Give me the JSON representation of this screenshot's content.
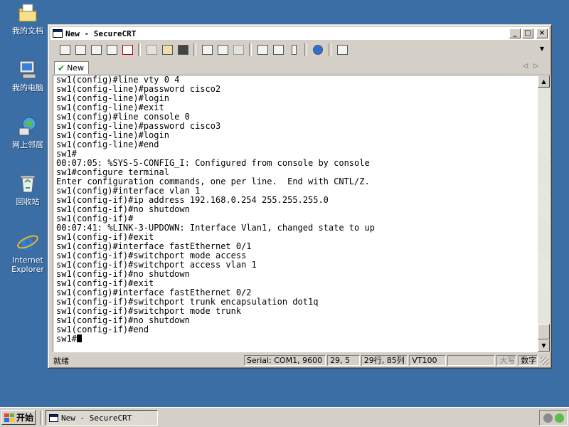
{
  "desktop": {
    "icons": [
      {
        "label": "我的文档",
        "icon": "my-documents-icon"
      },
      {
        "label": "我的电脑",
        "icon": "my-computer-icon"
      },
      {
        "label": "网上邻居",
        "icon": "network-places-icon"
      },
      {
        "label": "回收站",
        "icon": "recycle-bin-icon"
      },
      {
        "label": "Internet Explorer",
        "icon": "internet-explorer-icon"
      }
    ]
  },
  "window": {
    "title": "New - SecureCRT",
    "tab_label": "New"
  },
  "terminal": {
    "lines": [
      "sw1(config)#line vty 0 4",
      "sw1(config-line)#password cisco2",
      "sw1(config-line)#login",
      "sw1(config-line)#exit",
      "sw1(config)#line console 0",
      "sw1(config-line)#password cisco3",
      "sw1(config-line)#login",
      "sw1(config-line)#end",
      "sw1#",
      "00:07:05: %SYS-5-CONFIG_I: Configured from console by console",
      "sw1#configure terminal",
      "Enter configuration commands, one per line.  End with CNTL/Z.",
      "sw1(config)#interface vlan 1",
      "sw1(config-if)#ip address 192.168.0.254 255.255.255.0",
      "sw1(config-if)#no shutdown",
      "sw1(config-if)#",
      "00:07:41: %LINK-3-UPDOWN: Interface Vlan1, changed state to up",
      "sw1(config-if)#exit",
      "sw1(config)#interface fastEthernet 0/1",
      "sw1(config-if)#switchport mode access",
      "sw1(config-if)#switchport access vlan 1",
      "sw1(config-if)#no shutdown",
      "sw1(config-if)#exit",
      "sw1(config)#interface fastEthernet 0/2",
      "sw1(config-if)#switchport trunk encapsulation dot1q",
      "sw1(config-if)#switchport mode trunk",
      "sw1(config-if)#no shutdown",
      "sw1(config-if)#end"
    ],
    "prompt": "sw1#"
  },
  "status": {
    "ready": "就绪",
    "serial": "Serial: COM1, 9600",
    "cursor_pos": "29,  5",
    "rows_cols": "29行, 85列",
    "terminal_type": "VT100",
    "caps": "大写",
    "num": "数字"
  },
  "taskbar": {
    "start_label": "开始",
    "task_title": "New - SecureCRT"
  }
}
